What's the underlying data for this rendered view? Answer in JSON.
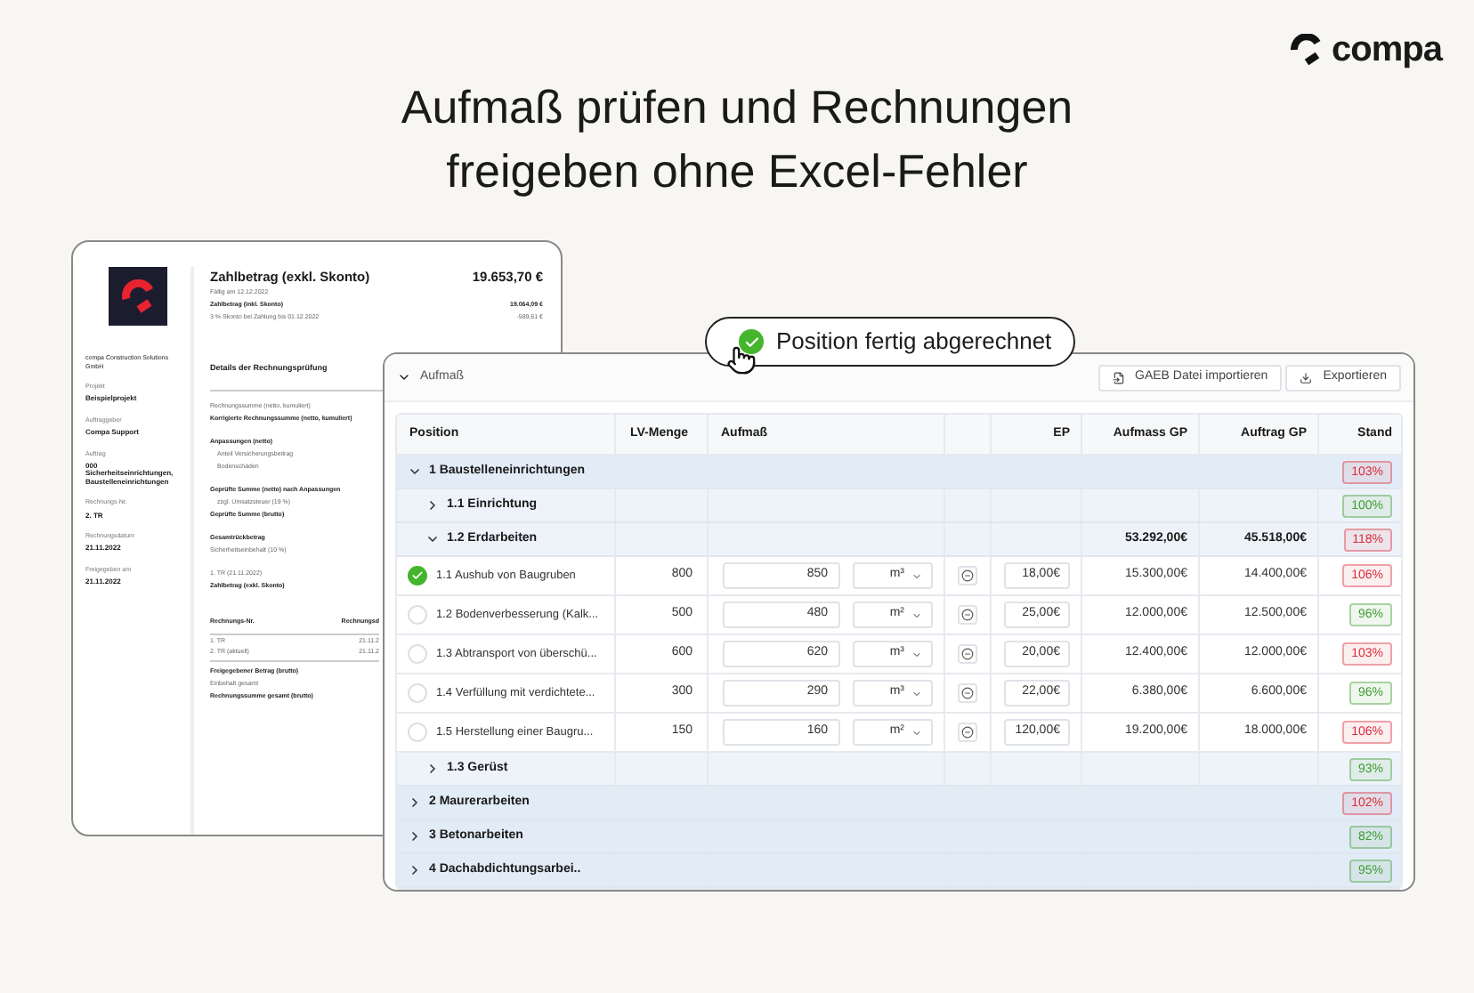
{
  "brand": {
    "name": "compa"
  },
  "headline": "Aufmaß prüfen und Rechnungen freigeben ohne Excel-Fehler",
  "invoice": {
    "company": "compa Construction Solutions GmbH",
    "fields": [
      {
        "label": "Projekt",
        "value": "Beispielprojekt"
      },
      {
        "label": "Auftraggeber",
        "value": "Compa Support"
      },
      {
        "label": "Auftrag",
        "value": "000 Sicherheitseinrichtungen, Baustelleneinrichtungen"
      },
      {
        "label": "Rechnungs-Nr.",
        "value": "2. TR"
      },
      {
        "label": "Rechnungsdatum",
        "value": "21.11.2022"
      },
      {
        "label": "Freigegeben am",
        "value": "21.11.2022"
      }
    ],
    "lines": [
      {
        "kind": "title",
        "label": "Zahlbetrag (exkl. Skonto)",
        "amount": "19.653,70 €"
      },
      {
        "kind": "plain",
        "label": "Fällig am 12.12.2022"
      },
      {
        "kind": "bold",
        "label": "Zahlbetrag (inkl. Skonto)",
        "amount": "19.064,09 €"
      },
      {
        "kind": "plain",
        "label": "3 % Skonto bei Zahlung bis 01.12.2022",
        "amount": "-589,61 €"
      },
      {
        "kind": "heading",
        "label": "Details der Rechnungsprüfung"
      },
      {
        "kind": "plain",
        "label": "Rechnungssumme (netto, kumuliert)"
      },
      {
        "kind": "bold",
        "label": "Korrigierte Rechnungssumme (netto, kumuliert)"
      },
      {
        "kind": "gap"
      },
      {
        "kind": "bold",
        "label": "Anpassungen (netto)"
      },
      {
        "kind": "indent",
        "label": "Anteil Versicherungsbeitrag"
      },
      {
        "kind": "indent",
        "label": "Bodenschäden"
      },
      {
        "kind": "gap"
      },
      {
        "kind": "bold",
        "label": "Geprüfte Summe (netto) nach Anpassungen"
      },
      {
        "kind": "indent",
        "label": "zzgl. Umsatzsteuer (19 %)"
      },
      {
        "kind": "bold",
        "label": "Geprüfte Summe (brutto)"
      },
      {
        "kind": "gap"
      },
      {
        "kind": "bold",
        "label": "Gesamtrückbetrag"
      },
      {
        "kind": "plain",
        "label": "Sicherheitseinbehalt (10 %)"
      },
      {
        "kind": "gap"
      },
      {
        "kind": "plain",
        "label": "1. TR (21.11.2022)"
      },
      {
        "kind": "bold",
        "label": "Zahlbetrag (exkl. Skonto)"
      }
    ],
    "history_columns": [
      "Rechnungs-Nr.",
      "Rechnungsd"
    ],
    "history_rows": [
      [
        "1. TR",
        "21.11.2"
      ],
      [
        "2. TR (aktuell)",
        "21.11.2"
      ]
    ],
    "totals": [
      {
        "kind": "bold",
        "label": "Freigegebener Betrag (brutto)"
      },
      {
        "kind": "plain",
        "label": "Einbehalt gesamt"
      },
      {
        "kind": "bold",
        "label": "Rechnungssumme gesamt (brutto)"
      }
    ]
  },
  "toast": {
    "text": "Position fertig abgerechnet"
  },
  "panel": {
    "title": "Aufmaß",
    "expanded": true,
    "buttons": [
      {
        "kind": "import",
        "label": "GAEB Datei importieren"
      },
      {
        "kind": "export",
        "label": "Exportieren"
      }
    ]
  },
  "table": {
    "columns": [
      "Position",
      "LV-Menge",
      "Aufmaß",
      "",
      "EP",
      "Aufmass GP",
      "Auftrag GP",
      "Stand"
    ],
    "rows": [
      {
        "kind": "group",
        "label": "1 Baustelleneinrichtungen",
        "expanded": true,
        "stand": "103%",
        "color": "#d92d3a",
        "children": [
          {
            "kind": "group",
            "label": "1.1 Einrichtung",
            "expanded": false,
            "stand": "100%",
            "color": "#3f9c2f"
          },
          {
            "kind": "group",
            "label": "1.2 Erdarbeiten",
            "expanded": true,
            "aufmass_gp": "53.292,00€",
            "auftrag_gp": "45.518,00€",
            "stand": "118%",
            "color": "#d92d3a",
            "children": [
              {
                "kind": "item",
                "done": true,
                "label": "1.1 Aushub von Baugruben",
                "lv": "800",
                "aufmass": "850",
                "unit": "m³",
                "ep": "18,00€",
                "aufmass_gp": "15.300,00€",
                "auftrag_gp": "14.400,00€",
                "stand": "106%",
                "color": "#d92d3a"
              },
              {
                "kind": "item",
                "done": false,
                "label": "1.2 Bodenverbesserung (Kalk...",
                "lv": "500",
                "aufmass": "480",
                "unit": "m²",
                "ep": "25,00€",
                "aufmass_gp": "12.000,00€",
                "auftrag_gp": "12.500,00€",
                "stand": "96%",
                "color": "#3f9c2f"
              },
              {
                "kind": "item",
                "done": false,
                "label": "1.3 Abtransport von überschü...",
                "lv": "600",
                "aufmass": "620",
                "unit": "m³",
                "ep": "20,00€",
                "aufmass_gp": "12.400,00€",
                "auftrag_gp": "12.000,00€",
                "stand": "103%",
                "color": "#d92d3a"
              },
              {
                "kind": "item",
                "done": false,
                "label": "1.4 Verfüllung mit verdichtete...",
                "lv": "300",
                "aufmass": "290",
                "unit": "m³",
                "ep": "22,00€",
                "aufmass_gp": "6.380,00€",
                "auftrag_gp": "6.600,00€",
                "stand": "96%",
                "color": "#3f9c2f"
              },
              {
                "kind": "item",
                "done": false,
                "label": "1.5 Herstellung einer Baugru...",
                "lv": "150",
                "aufmass": "160",
                "unit": "m²",
                "ep": "120,00€",
                "aufmass_gp": "19.200,00€",
                "auftrag_gp": "18.000,00€",
                "stand": "106%",
                "color": "#d92d3a"
              }
            ]
          },
          {
            "kind": "group",
            "label": "1.3 Gerüst",
            "expanded": false,
            "stand": "93%",
            "color": "#3f9c2f"
          }
        ]
      },
      {
        "kind": "group",
        "label": "2 Maurerarbeiten",
        "expanded": false,
        "stand": "102%",
        "color": "#d92d3a"
      },
      {
        "kind": "group",
        "label": "3 Betonarbeiten",
        "expanded": false,
        "stand": "82%",
        "color": "#3f9c2f"
      },
      {
        "kind": "group",
        "label": "4 Dachabdichtungsarbei..",
        "expanded": false,
        "stand": "95%",
        "color": "#3f9c2f"
      }
    ]
  }
}
